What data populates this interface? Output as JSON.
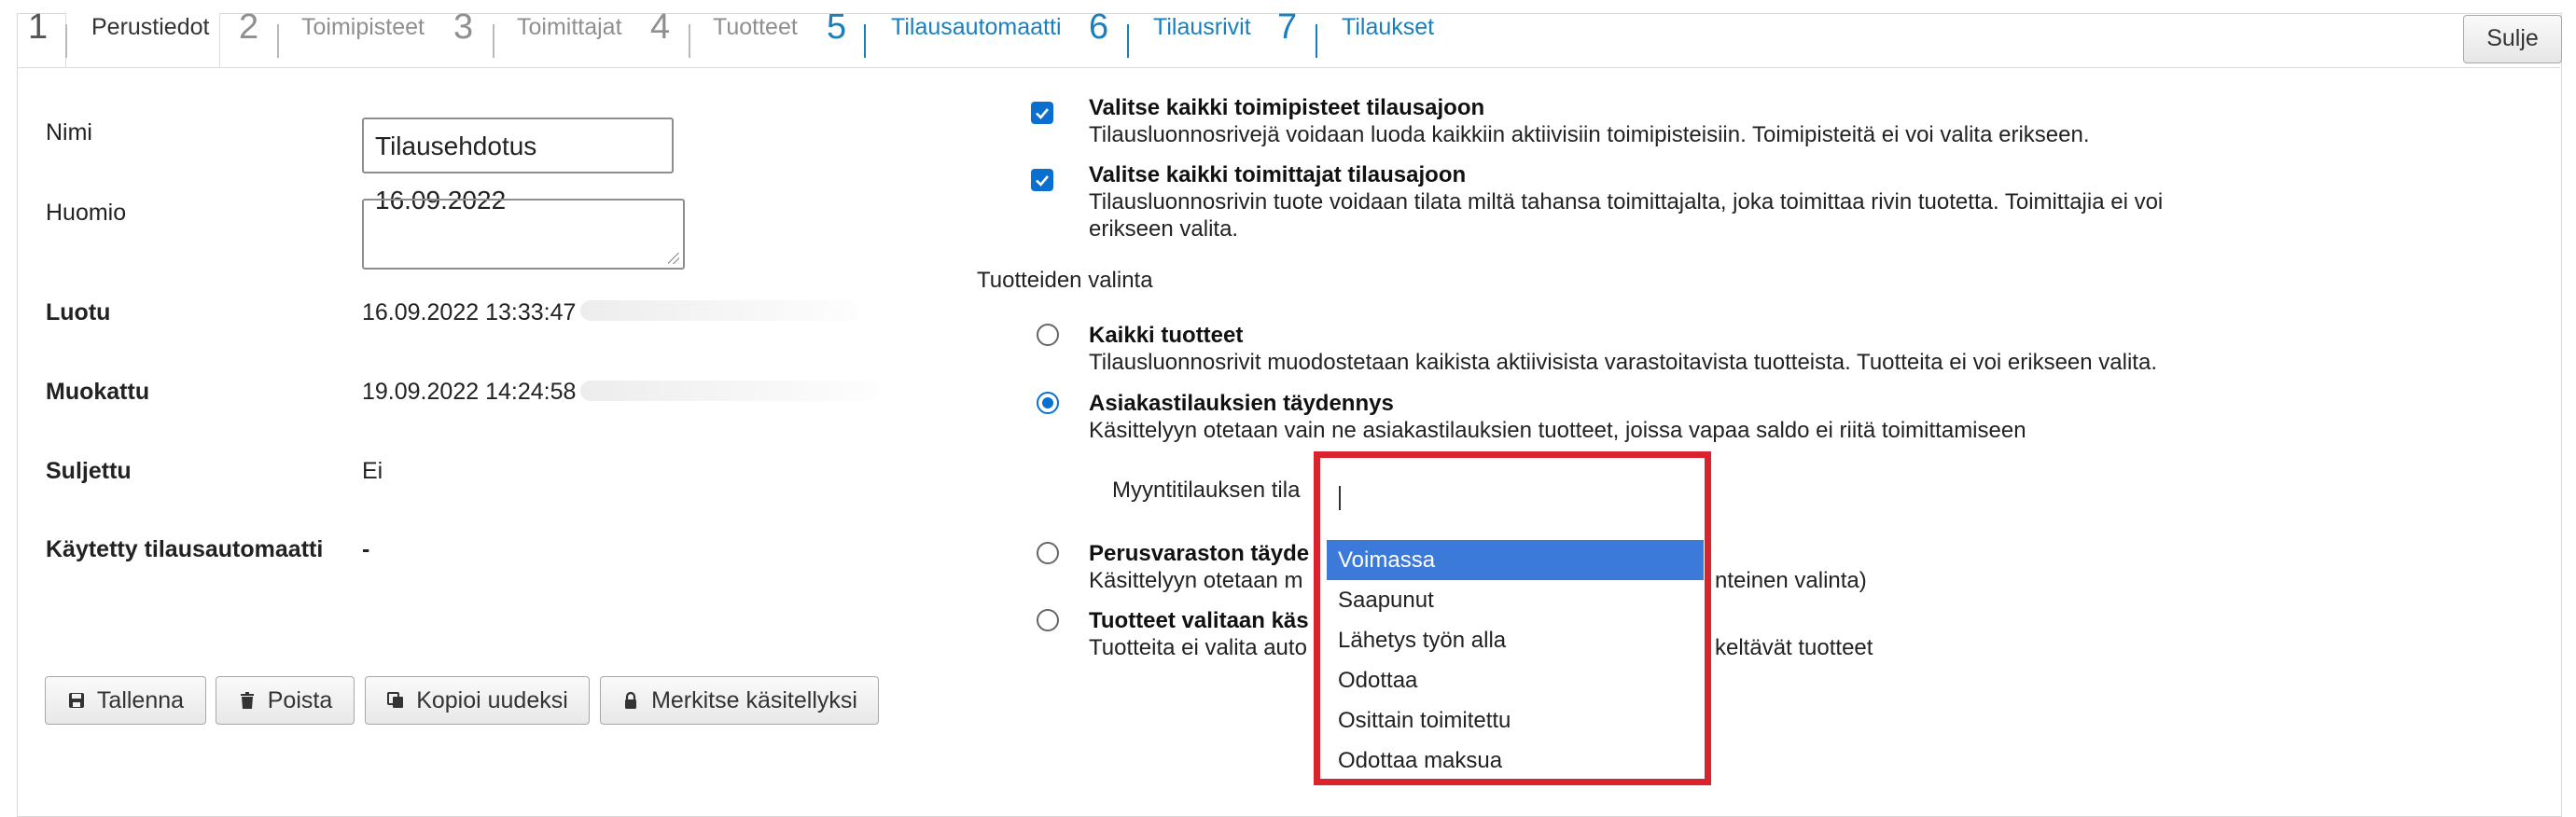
{
  "tabs": [
    {
      "num": "1",
      "label": "Perustiedot",
      "state": "current"
    },
    {
      "num": "2",
      "label": "Toimipisteet",
      "state": "disabled"
    },
    {
      "num": "3",
      "label": "Toimittajat",
      "state": "disabled"
    },
    {
      "num": "4",
      "label": "Tuotteet",
      "state": "disabled"
    },
    {
      "num": "5",
      "label": "Tilausautomaatti",
      "state": "link"
    },
    {
      "num": "6",
      "label": "Tilausrivit",
      "state": "link"
    },
    {
      "num": "7",
      "label": "Tilaukset",
      "state": "link"
    }
  ],
  "close_label": "Sulje",
  "form": {
    "name_label": "Nimi",
    "name_value": "Tilausehdotus 16.09.2022",
    "note_label": "Huomio",
    "note_value": "",
    "created_label": "Luotu",
    "created_value": "16.09.2022 13:33:47",
    "modified_label": "Muokattu",
    "modified_value": "19.09.2022 14:24:58",
    "closed_label": "Suljettu",
    "closed_value": "Ei",
    "automat_label": "Käytetty tilausautomaatti",
    "automat_value": "-"
  },
  "buttons": {
    "save": "Tallenna",
    "delete": "Poista",
    "copy": "Kopioi uudeksi",
    "mark": "Merkitse käsitellyksi"
  },
  "checkboxes": [
    {
      "title": "Valitse kaikki toimipisteet tilausajoon",
      "desc": "Tilausluonnosrivejä voidaan luoda kaikkiin aktiivisiin toimipisteisiin. Toimipisteitä ei voi valita erikseen.",
      "checked": true
    },
    {
      "title": "Valitse kaikki toimittajat tilausajoon",
      "desc": "Tilausluonnosrivin tuote voidaan tilata miltä tahansa toimittajalta, joka toimittaa rivin tuotetta. Toimittajia ei voi erikseen valita.",
      "checked": true
    }
  ],
  "product_section_label": "Tuotteiden valinta",
  "radios": [
    {
      "title": "Kaikki tuotteet",
      "desc": "Tilausluonnosrivit muodostetaan kaikista aktiivisista varastoitavista tuotteista. Tuotteita ei voi erikseen valita.",
      "selected": false
    },
    {
      "title": "Asiakastilauksien täydennys",
      "desc": "Käsittelyyn otetaan vain ne asiakastilauksien tuotteet, joissa vapaa saldo ei riitä toimittamiseen",
      "selected": true
    },
    {
      "title": "Perusvaraston täyde",
      "desc": "Käsittelyyn otetaan m",
      "desc_tail": "nteinen valinta)",
      "selected": false
    },
    {
      "title": "Tuotteet valitaan käs",
      "desc": "Tuotteita ei valita auto",
      "desc_tail": "keltävät tuotteet",
      "selected": false
    }
  ],
  "sales_order_state_label": "Myyntitilauksen tila",
  "dropdown_options": [
    {
      "label": "Voimassa",
      "selected": true
    },
    {
      "label": "Saapunut",
      "selected": false
    },
    {
      "label": "Lähetys työn alla",
      "selected": false
    },
    {
      "label": "Odottaa",
      "selected": false
    },
    {
      "label": "Osittain toimitettu",
      "selected": false
    },
    {
      "label": "Odottaa maksua",
      "selected": false
    }
  ],
  "colors": {
    "link": "#1a7fbd",
    "highlight": "#d9232e",
    "selected_option": "#3b7ad8",
    "checkbox": "#0b6fd0"
  }
}
